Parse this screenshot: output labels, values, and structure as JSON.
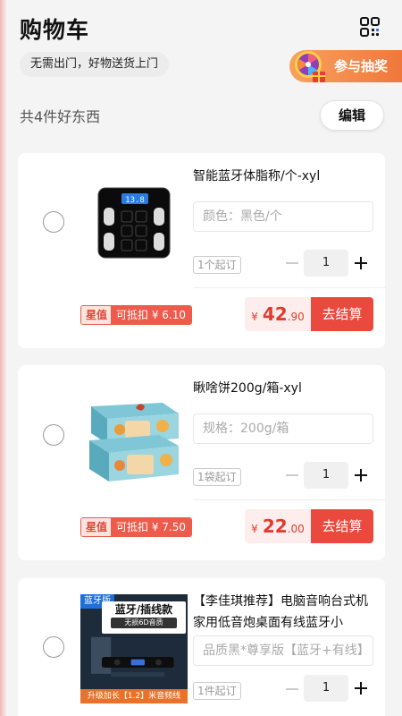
{
  "header": {
    "title": "购物车",
    "subtitle": "无需出门，好物送货上门",
    "lottery_label": "参与抽奖"
  },
  "summary": {
    "count_text": "共4件好东西",
    "edit_label": "编辑"
  },
  "items": [
    {
      "name": "智能蓝牙体脂称/个-xyl",
      "spec": "颜色：黑色/个",
      "moq": "1个起订",
      "quantity": "1",
      "badge_star": "星值",
      "badge_deduct": "可抵扣 ¥ 6.10",
      "price_currency": "¥",
      "price_int": "42",
      "price_dec": ".90",
      "checkout_label": "去结算",
      "thumb_icon": "body-fat-scale-image",
      "scale_display": "13.8"
    },
    {
      "name": "瞅啥饼200g/箱-xyl",
      "spec": "规格：200g/箱",
      "moq": "1袋起订",
      "quantity": "1",
      "badge_star": "星值",
      "badge_deduct": "可抵扣 ¥ 7.50",
      "price_currency": "¥",
      "price_int": "22",
      "price_dec": ".00",
      "checkout_label": "去结算",
      "thumb_icon": "pastry-box-image"
    },
    {
      "name": "【李佳琪推荐】电脑音响台式机家用低音炮桌面有线蓝牙小",
      "spec": "品质黑*尊享版【蓝牙+有线】",
      "moq": "1件起订",
      "quantity": "1",
      "thumb_icon": "speaker-image",
      "thumb_tag": "蓝牙版",
      "thumb_headline": "蓝牙/插线款",
      "thumb_sub": "无损6D音质",
      "thumb_footer": "升级加长【1.2】米音频线"
    }
  ],
  "colors": {
    "accent": "#ea4a3d",
    "price": "#e23b2e",
    "lottery": "#f0773c",
    "background": "#f4f4f4"
  }
}
